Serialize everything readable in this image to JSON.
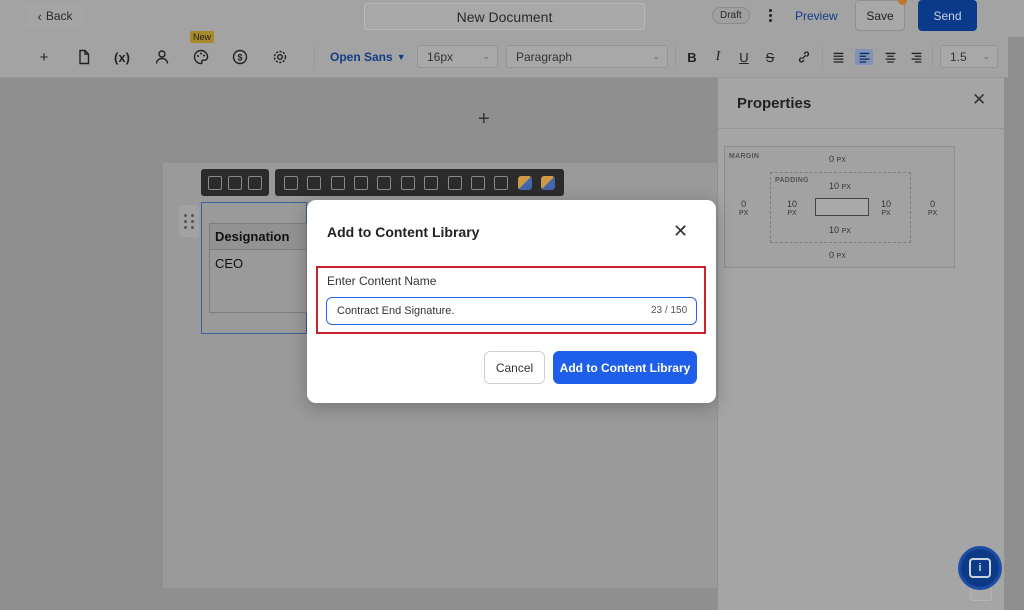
{
  "header": {
    "back_label": "Back",
    "doc_title": "New Document",
    "status_badge": "Draft",
    "preview_label": "Preview",
    "save_label": "Save",
    "send_label": "Send"
  },
  "toolbar": {
    "new_tag": "New",
    "font_family": "Open Sans",
    "font_size": "16px",
    "block_type": "Paragraph",
    "line_height": "1.5",
    "variable_symbol": "(x)"
  },
  "canvas": {
    "table_header": "Designation",
    "table_cell": "CEO"
  },
  "properties": {
    "title": "Properties",
    "margin_label": "MARGIN",
    "padding_label": "PADDING",
    "margin_top": "0",
    "margin_bottom": "0",
    "margin_left": "0",
    "margin_right": "0",
    "padding_top": "10",
    "padding_bottom": "10",
    "padding_left": "10",
    "padding_right": "10",
    "unit": "PX"
  },
  "modal": {
    "title": "Add to Content Library",
    "field_label": "Enter Content Name",
    "input_value": "Contract End Signature.",
    "char_count": "23 / 150",
    "cancel_label": "Cancel",
    "confirm_label": "Add to Content Library"
  },
  "colors": {
    "primary": "#1f5ee8",
    "highlight": "#c8232b",
    "overlay": "#8f8f8f"
  }
}
